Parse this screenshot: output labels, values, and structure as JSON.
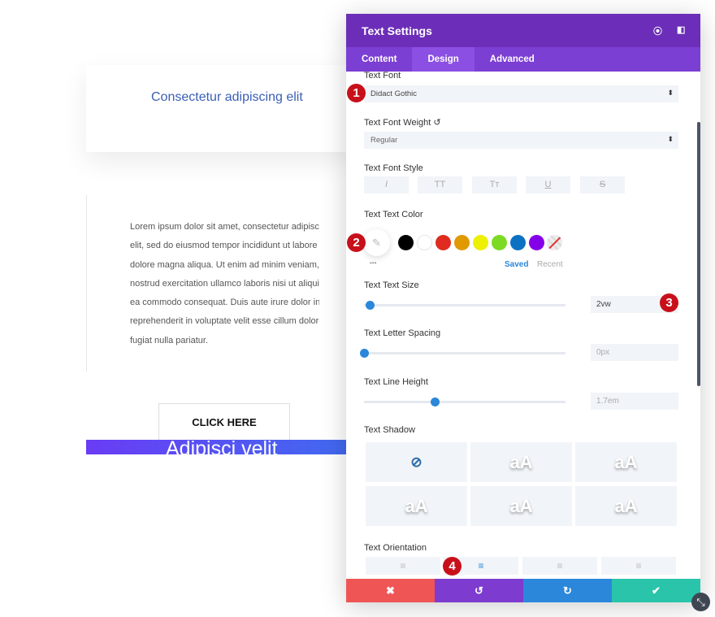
{
  "page": {
    "card_title": "Consectetur adipiscing elit",
    "body_lines": [
      "Lorem ipsum dolor sit amet, consectetur adipiscing",
      "elit, sed do eiusmod tempor incididunt ut labore et",
      "dolore magna aliqua. Ut enim ad minim veniam, quis",
      "nostrud exercitation ullamco laboris nisi ut aliquip ex",
      "ea commodo consequat. Duis aute irure dolor in",
      "reprehenderit in voluptate velit esse cillum dolore eu",
      "fugiat nulla pariatur."
    ],
    "cta": "CLICK HERE",
    "gradient_heading": "Adipisci velit"
  },
  "panel": {
    "title": "Text Settings",
    "tabs": [
      "Content",
      "Design",
      "Advanced"
    ],
    "active_tab": "Design",
    "font_label": "Text Font",
    "font_value": "Didact Gothic",
    "weight_label": "Text Font Weight",
    "weight_value": "Regular",
    "style_label": "Text Font Style",
    "style_buttons": [
      "I",
      "TT",
      "Tт",
      "U",
      "S"
    ],
    "color_label": "Text Text Color",
    "swatches": [
      "#000000",
      "#ffffff",
      "#e02b20",
      "#e09900",
      "#edf000",
      "#7cda24",
      "#0c71c3",
      "#8300e9"
    ],
    "saved": "Saved",
    "recent": "Recent",
    "more": "•••",
    "size_label": "Text Text Size",
    "size_value": "2vw",
    "size_slider": 0.03,
    "spacing_label": "Text Letter Spacing",
    "spacing_value": "0px",
    "spacing_slider": 0.0,
    "lineheight_label": "Text Line Height",
    "lineheight_value": "1.7em",
    "lineheight_slider": 0.35,
    "shadow_label": "Text Shadow",
    "shadow_sample": "aA",
    "orientation_label": "Text Orientation",
    "orientation_active": 1
  },
  "footer": {
    "colors": [
      "#ef5555",
      "#7e3bd0",
      "#2b87da",
      "#29c4a9"
    ]
  },
  "badges": [
    "1",
    "2",
    "3",
    "4"
  ]
}
